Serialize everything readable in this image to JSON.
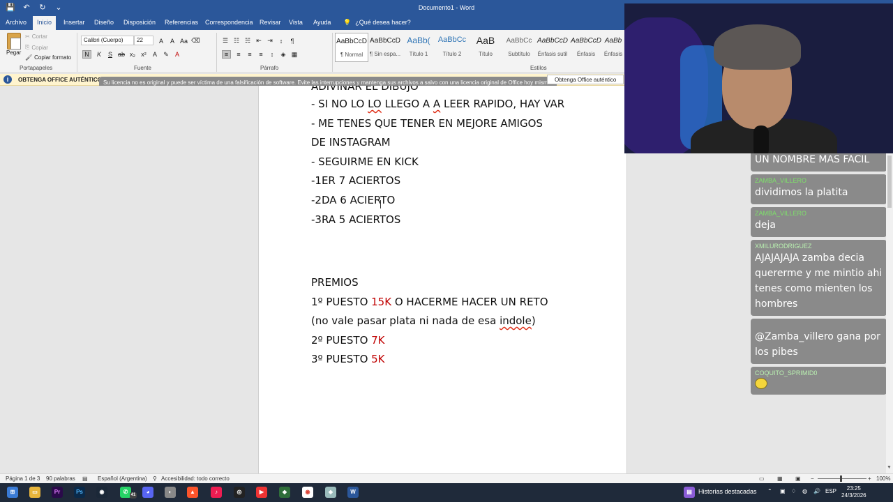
{
  "titlebar": {
    "title": "Documento1 - Word",
    "qat": [
      "💾",
      "↶",
      "↻",
      "⌄"
    ]
  },
  "tabs": [
    "Archivo",
    "Inicio",
    "Insertar",
    "Diseño",
    "Disposición",
    "Referencias",
    "Correspondencia",
    "Revisar",
    "Vista",
    "Ayuda"
  ],
  "tell_me": "¿Qué desea hacer?",
  "ribbon": {
    "paste": "Pegar",
    "cut": "Cortar",
    "copy": "Copiar",
    "format_painter": "Copiar formato",
    "font_name": "Calibri (Cuerpo)",
    "font_size": "22",
    "groups": [
      "Portapapeles",
      "Fuente",
      "Párrafo",
      "Estilos"
    ],
    "styles": [
      {
        "preview": "AaBbCcD",
        "name": "¶ Normal"
      },
      {
        "preview": "AaBbCcD",
        "name": "¶ Sin espa..."
      },
      {
        "preview": "AaBb(",
        "name": "Título 1"
      },
      {
        "preview": "AaBbCc",
        "name": "Título 2"
      },
      {
        "preview": "AaB",
        "name": "Título"
      },
      {
        "preview": "AaBbCc",
        "name": "Subtítulo"
      },
      {
        "preview": "AaBbCcD",
        "name": "Énfasis sutil"
      },
      {
        "preview": "AaBbCcD",
        "name": "Énfasis"
      },
      {
        "preview": "AaBb",
        "name": "Énfasis"
      }
    ]
  },
  "warning": {
    "title": "OBTENGA OFFICE AUTÉNTICO",
    "message": "Su licencia no es original y puede ser víctima de una falsificación de software. Evite las interrupciones y mantenga sus archivos a salvo con una licencia original de Office hoy mismo.",
    "button": "Obtenga Office auténtico"
  },
  "document": {
    "cut_top": "ADIVINAR EL DIBUJO",
    "l1a": "- SI NO LO ",
    "l1b": "LO",
    "l1c": " LLEGO A ",
    "l1d": "A",
    "l1e": " LEER RAPIDO, HAY VAR",
    "l2": "- ME TENES QUE TENER EN MEJORE AMIGOS",
    "l3": "DE INSTAGRAM",
    "l4": "- SEGUIRME EN KICK",
    "l5": "-1ER 7 ACIERTOS",
    "l6": "-2DA 6 ACIERTO",
    "l7": "-3RA 5 ACIERTOS",
    "premios": "PREMIOS",
    "p1a": "1º PUESTO ",
    "p1b": "15K",
    "p1c": " O HACERME HACER UN RETO",
    "p1d": "(no vale pasar plata ni nada de esa ",
    "p1e": "indole",
    "p1f": ")",
    "p2a": "2º PUESTO ",
    "p2b": "7K",
    "p3a": "3º PUESTO ",
    "p3b": "5K"
  },
  "chat": [
    {
      "user": "",
      "text": "UN NOMBRE MAS FACIL",
      "color": "#ffffff"
    },
    {
      "user": "ZAMBA_VILLERO",
      "text": "dividimos la platita",
      "color": "#7ee06a"
    },
    {
      "user": "ZAMBA_VILLERO",
      "text": "deja",
      "color": "#7ee06a"
    },
    {
      "user": "XMILURODRIGUEZ",
      "text": "AJAJAJAJA zamba decia quererme y me mintio ahi tenes como mienten los hombres",
      "color": "#b9f0b0"
    },
    {
      "user": "",
      "text": "@Zamba_villero gana por los pibes",
      "color": "#e89a2c"
    },
    {
      "user": "COQUITO_SPRIMID0",
      "text": "",
      "color": "#b9f0b0"
    }
  ],
  "status": {
    "page": "Página 1 de 3",
    "words": "90 palabras",
    "lang": "Español (Argentina)",
    "access": "Accesibilidad: todo correcto",
    "zoom": "100%"
  },
  "taskbar": {
    "news": "Historias destacadas",
    "lang": "ESP",
    "time": "23:25",
    "date": "24/3/2026",
    "badge": "41"
  }
}
